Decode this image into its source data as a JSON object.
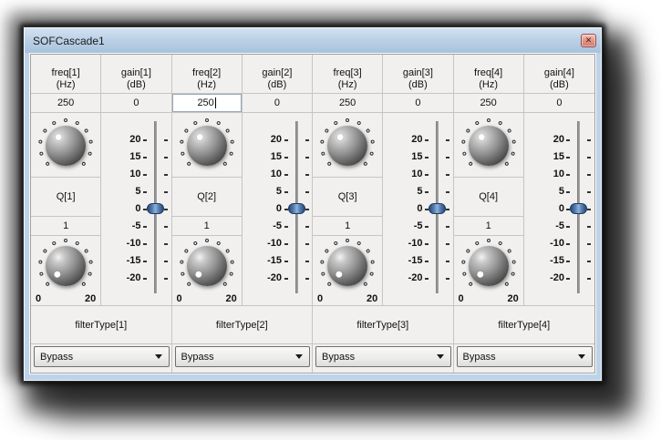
{
  "window": {
    "title": "SOFCascade1",
    "close_icon": "✕"
  },
  "slider_scale": [
    "20",
    "15",
    "10",
    "5",
    "0",
    "-5",
    "-10",
    "-15",
    "-20"
  ],
  "channels": [
    {
      "freq_label": "freq[1]",
      "freq_unit": "(Hz)",
      "freq_value": "250",
      "gain_label": "gain[1]",
      "gain_unit": "(dB)",
      "gain_value": "0",
      "q_label": "Q[1]",
      "q_value": "1",
      "q_min": "0",
      "q_max": "20",
      "filter_label": "filterType[1]",
      "filter_value": "Bypass"
    },
    {
      "freq_label": "freq[2]",
      "freq_unit": "(Hz)",
      "freq_value": "250",
      "freq_editing": true,
      "gain_label": "gain[2]",
      "gain_unit": "(dB)",
      "gain_value": "0",
      "q_label": "Q[2]",
      "q_value": "1",
      "q_min": "0",
      "q_max": "20",
      "filter_label": "filterType[2]",
      "filter_value": "Bypass"
    },
    {
      "freq_label": "freq[3]",
      "freq_unit": "(Hz)",
      "freq_value": "250",
      "gain_label": "gain[3]",
      "gain_unit": "(dB)",
      "gain_value": "0",
      "q_label": "Q[3]",
      "q_value": "1",
      "q_min": "0",
      "q_max": "20",
      "filter_label": "filterType[3]",
      "filter_value": "Bypass"
    },
    {
      "freq_label": "freq[4]",
      "freq_unit": "(Hz)",
      "freq_value": "250",
      "gain_label": "gain[4]",
      "gain_unit": "(dB)",
      "gain_value": "0",
      "q_label": "Q[4]",
      "q_value": "1",
      "q_min": "0",
      "q_max": "20",
      "filter_label": "filterType[4]",
      "filter_value": "Bypass"
    }
  ],
  "colors": {
    "titlebar_top": "#d3e2f1",
    "titlebar_bottom": "#a8c3dd",
    "frame": "#bdd3ea",
    "cell_bg": "#f1f0ef",
    "grid_line": "#c6c5c4",
    "thumb_blue": "#577fb2",
    "close_bg": "#e09a8c"
  }
}
